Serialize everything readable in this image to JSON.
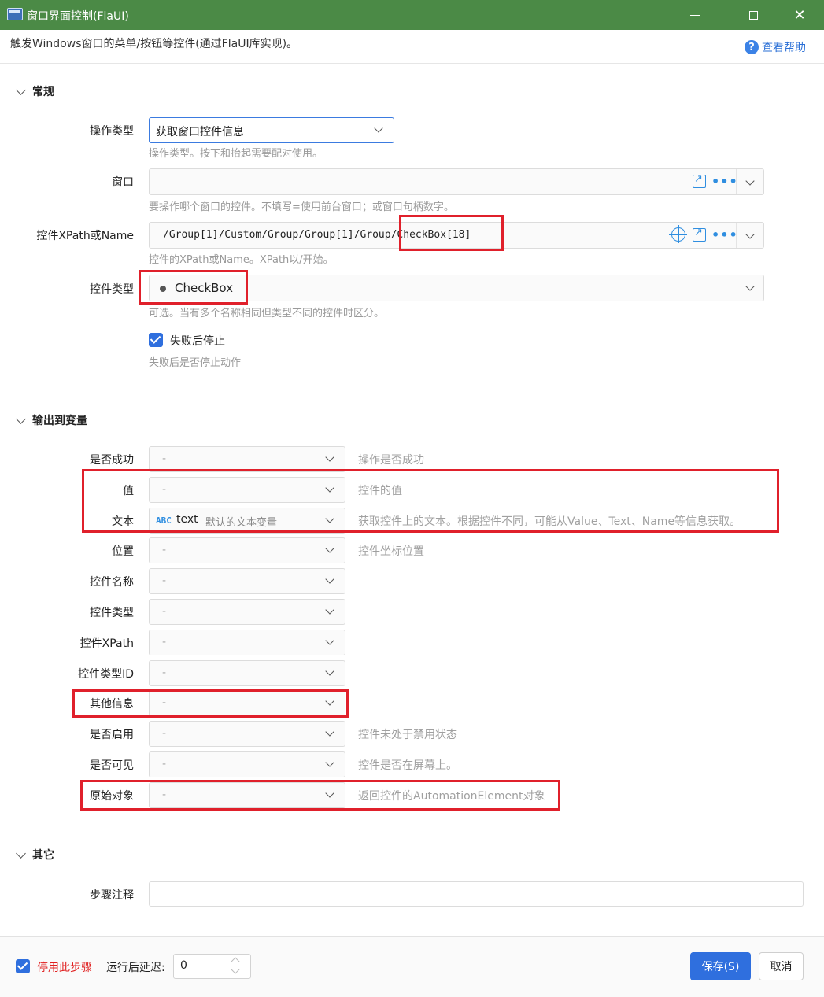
{
  "window": {
    "title": "窗口界面控制(FlaUI)",
    "minimize": "—",
    "maximize": "☐",
    "close": "✕"
  },
  "header": {
    "description": "触发Windows窗口的菜单/按钮等控件(通过FlaUI库实现)。",
    "help_label": "查看帮助",
    "help_glyph": "?"
  },
  "general": {
    "title": "常规",
    "operation_type": {
      "label": "操作类型",
      "value": "获取窗口控件信息",
      "hint": "操作类型。按下和抬起需要配对使用。"
    },
    "window": {
      "label": "窗口",
      "value": "",
      "hint": "要操作哪个窗口的控件。不填写=使用前台窗口；或窗口句柄数字。",
      "more": "•••"
    },
    "xpath": {
      "label": "控件XPath或Name",
      "value": "/Group[1]/Custom/Group/Group[1]/Group/CheckBox[18]",
      "hint": "控件的XPath或Name。XPath以/开始。",
      "more": "•••"
    },
    "control_type": {
      "label": "控件类型",
      "value": "CheckBox",
      "hint": "可选。当有多个名称相同但类型不同的控件时区分。"
    },
    "stop_on_fail": {
      "label": "失败后停止",
      "hint": "失败后是否停止动作"
    }
  },
  "output": {
    "title": "输出到变量",
    "rows": [
      {
        "label": "是否成功",
        "value": "-",
        "hint": "操作是否成功"
      },
      {
        "label": "值",
        "value": "-",
        "hint": "控件的值"
      },
      {
        "label": "文本",
        "value": "text",
        "badge": "ABC",
        "default_text": "默认的文本变量",
        "hint": "获取控件上的文本。根据控件不同，可能从Value、Text、Name等信息获取。"
      },
      {
        "label": "位置",
        "value": "-",
        "hint": "控件坐标位置"
      },
      {
        "label": "控件名称",
        "value": "-",
        "hint": ""
      },
      {
        "label": "控件类型",
        "value": "-",
        "hint": ""
      },
      {
        "label": "控件XPath",
        "value": "-",
        "hint": ""
      },
      {
        "label": "控件类型ID",
        "value": "-",
        "hint": ""
      },
      {
        "label": "其他信息",
        "value": "-",
        "hint": ""
      },
      {
        "label": "是否启用",
        "value": "-",
        "hint": "控件未处于禁用状态"
      },
      {
        "label": "是否可见",
        "value": "-",
        "hint": "控件是否在屏幕上。"
      },
      {
        "label": "原始对象",
        "value": "-",
        "hint": "返回控件的AutomationElement对象"
      }
    ]
  },
  "other": {
    "title": "其它",
    "comment": {
      "label": "步骤注释",
      "value": ""
    }
  },
  "footer": {
    "disable_step": "停用此步骤",
    "delay_label": "运行后延迟:",
    "delay_value": "0",
    "save": "保存(S)",
    "cancel": "取消"
  },
  "colors": {
    "titlebar": "#4b8a46",
    "primary": "#2f6fde",
    "highlight": "#e0202b",
    "disable_step_text": "#e02020"
  }
}
